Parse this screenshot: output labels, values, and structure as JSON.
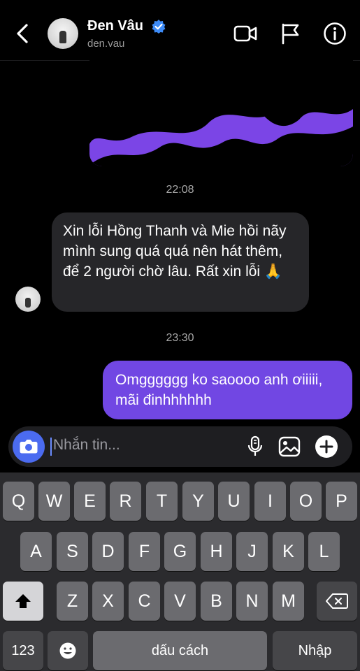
{
  "header": {
    "name": "Đen Vâu",
    "handle": "den.vau",
    "icons": [
      "back-chevron-icon",
      "verified-badge-icon",
      "video-call-icon",
      "flag-icon",
      "info-icon"
    ]
  },
  "conversation": {
    "time_1": "22:08",
    "incoming_message": "Xin lỗi Hồng Thanh và Mie hồi nãy mình sung quá quá nên hát thêm, để 2 người chờ lâu. Rất xin lỗi 🙏",
    "time_2": "23:30",
    "outgoing_message": "Omgggggg ko saoooo anh ơiiiii, mãi đinhhhhhh"
  },
  "composer": {
    "placeholder": "Nhắn tin...",
    "icons": [
      "camera-icon",
      "microphone-icon",
      "image-icon",
      "plus-icon"
    ]
  },
  "keyboard": {
    "row1": [
      "Q",
      "W",
      "E",
      "R",
      "T",
      "Y",
      "U",
      "I",
      "O",
      "P"
    ],
    "row2": [
      "A",
      "S",
      "D",
      "F",
      "G",
      "H",
      "J",
      "K",
      "L"
    ],
    "row3": [
      "Z",
      "X",
      "C",
      "V",
      "B",
      "N",
      "M"
    ],
    "numbers_label": "123",
    "space_label": "dấu cách",
    "return_label": "Nhập"
  },
  "colors": {
    "outgoing_bubble": "#7147e3",
    "incoming_bubble": "#262629",
    "camera_button": "#4b6bf0",
    "verified_badge": "#3d8bf7"
  }
}
